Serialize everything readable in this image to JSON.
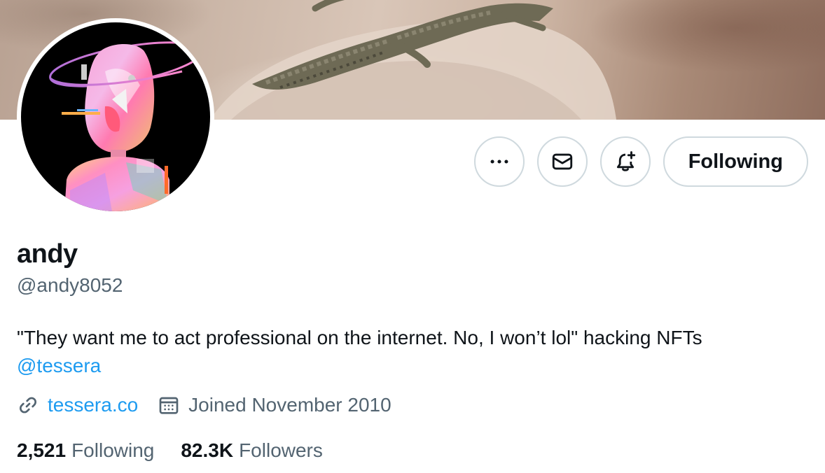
{
  "profile": {
    "name": "andy",
    "handle": "@andy8052",
    "bio_text": "\"They want me to act professional on the internet. No, I won’t lol\" hacking NFTs",
    "bio_mention": "@tessera",
    "website": "tessera.co",
    "joined": "Joined November 2010",
    "following_count": "2,521",
    "following_label": "Following",
    "followers_count": "82.3K",
    "followers_label": "Followers"
  },
  "actions": {
    "more_icon": "more-icon",
    "message_icon": "envelope-icon",
    "notify_icon": "bell-plus-icon",
    "follow_button_label": "Following"
  },
  "colors": {
    "accent": "#1d9bf0",
    "text_primary": "#0f1419",
    "text_secondary": "#536471",
    "border": "#cfd9de"
  }
}
